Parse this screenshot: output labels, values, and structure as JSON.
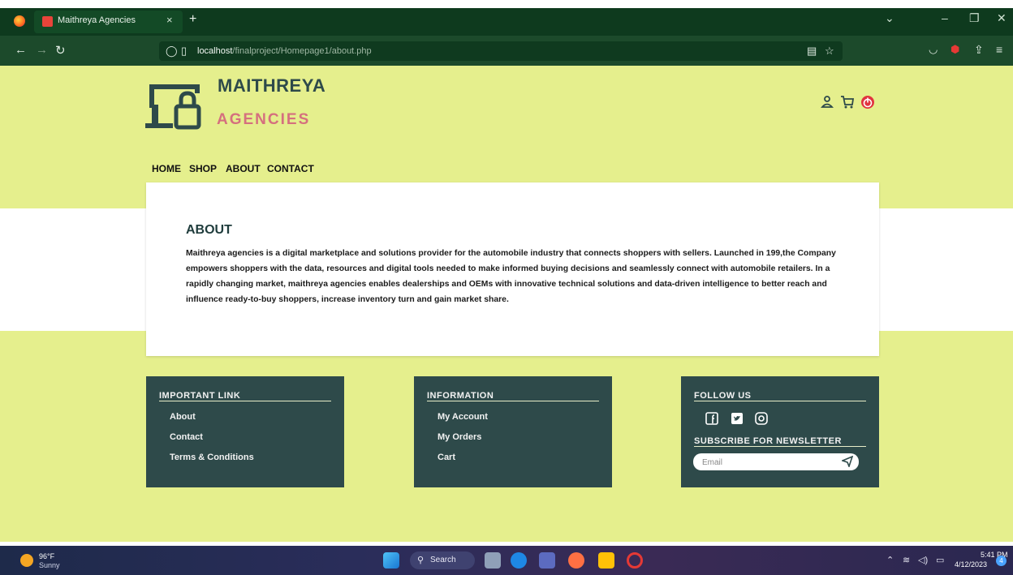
{
  "browser": {
    "tab_title": "Maithreya Agencies",
    "url_host": "localhost",
    "url_path": "/finalproject/Homepage1/about.php",
    "new_tab": "+",
    "tab_close": "×"
  },
  "site": {
    "brand_title": "MAITHREYA",
    "brand_sub": "AGENCIES",
    "nav": [
      "HOME",
      "SHOP",
      "ABOUT",
      "CONTACT"
    ],
    "header_icons": [
      "user-icon",
      "cart-icon",
      "power-icon"
    ]
  },
  "about": {
    "title": "ABOUT",
    "body": "Maithreya agencies is a digital marketplace and solutions provider for the automobile industry that connects shoppers with sellers. Launched in 199,the Company empowers shoppers with the data, resources and digital tools needed to make informed buying decisions and seamlessly connect with automobile retailers. In a rapidly changing market, maithreya agencies enables dealerships and OEMs with innovative technical solutions and data-driven intelligence to better reach and influence ready-to-buy shoppers, increase inventory turn and gain market share."
  },
  "footer": {
    "important": {
      "heading": "IMPORTANT LINK",
      "links": [
        "About",
        "Contact",
        "Terms & Conditions"
      ]
    },
    "information": {
      "heading": "INFORMATION",
      "links": [
        "My Account",
        "My Orders",
        "Cart"
      ]
    },
    "follow": {
      "heading": "FOLLOW US",
      "social_icons": [
        "facebook-icon",
        "twitter-icon",
        "instagram-icon"
      ],
      "newsletter_heading": "SUBSCRIBE FOR NEWSLETTER",
      "email_placeholder": "Email"
    }
  },
  "taskbar": {
    "temp": "96°F",
    "condition": "Sunny",
    "search_label": "Search",
    "time": "5:41 PM",
    "date": "4/12/2023",
    "notifications": "4"
  },
  "colors": {
    "page_bg": "#e5ef8d",
    "dark_teal": "#2e4a4a",
    "brand_pink": "#d5707e",
    "browser_green": "#1c4a2b"
  }
}
